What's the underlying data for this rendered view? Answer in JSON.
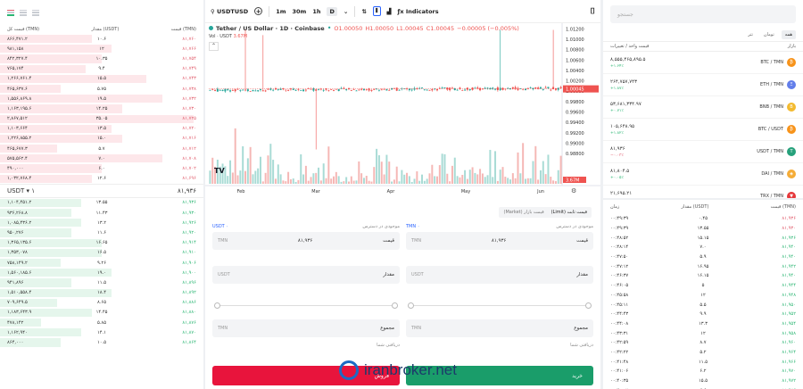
{
  "orderbook": {
    "headers": {
      "total": "قیمت کل (TMN)",
      "amount": "مقدار (USDT)",
      "price": "قیمت (TMN)"
    },
    "asks": [
      {
        "total": "۸۶۶,۴۷۱.۲",
        "amount": "۱۰.۶",
        "price": "۸۱,۷۶۰",
        "fill": 0.45
      },
      {
        "total": "۹۸۱,۱۵۸",
        "amount": "۱۲",
        "price": "۸۱,۷۶۶",
        "fill": 0.55
      },
      {
        "total": "۸۴۲,۳۲۷.۴",
        "amount": "۱۰.۳۵",
        "price": "۸۱,۷۵۴",
        "fill": 0.5
      },
      {
        "total": "۷۶۵,۱۷۴",
        "amount": "۹.۴",
        "price": "۸۱,۷۴۹",
        "fill": 0.42
      },
      {
        "total": "۱,۲۶۶,۷۶۱.۴",
        "amount": "۱۵.۵",
        "price": "۸۱,۷۴۳",
        "fill": 0.72
      },
      {
        "total": "۴۶۵,۶۳۷.۶",
        "amount": "۵.۷۵",
        "price": "۸۱,۷۳۸",
        "fill": 0.3
      },
      {
        "total": "۱,۵۵۶,۸۶۹.۸",
        "amount": "۱۹.۵",
        "price": "۸۱,۷۳۲",
        "fill": 0.8
      },
      {
        "total": "۱,۱۶۳,۱۹۵.۶",
        "amount": "۱۴.۲۵",
        "price": "۸۱,۷۳۰",
        "fill": 0.6
      },
      {
        "total": "۲,۸۶۷,۵۱۲",
        "amount": "۳۵.۰۵",
        "price": "۸۱,۷۲۵",
        "fill": 0.95
      },
      {
        "total": "۱,۱۰۳,۶۶۴",
        "amount": "۱۳.۵",
        "price": "۸۱,۷۲۰",
        "fill": 0.55
      },
      {
        "total": "۱,۲۲۶,۸۵۵.۲",
        "amount": "۱۵.۰",
        "price": "۸۱,۷۱۶",
        "fill": 0.6
      },
      {
        "total": "۴۶۵,۶۷۷.۳",
        "amount": "۵.۷",
        "price": "۸۱,۷۱۲",
        "fill": 0.28
      },
      {
        "total": "۵۷۵,۵۶۲.۴",
        "amount": "۷.۰",
        "price": "۸۱,۷۰۸",
        "fill": 0.8
      },
      {
        "total": "۴۹۰,۰۰۰",
        "amount": "۶.۰",
        "price": "۸۱,۷۰۲",
        "fill": 0.5
      },
      {
        "total": "۱,۰۳۲,۷۶۸.۴",
        "amount": "۱۲.۶",
        "price": "۸۱,۶۹۶",
        "fill": 0.45
      }
    ],
    "mid": {
      "unit": "USDT ▾ ۱",
      "price": "۸۱,۹۳۶"
    },
    "bids": [
      {
        "total": "۱,۱۰۴,۴۵۱.۲",
        "amount": "۱۳.۵۵",
        "price": "۸۱,۹۳۶",
        "fill": 0.4
      },
      {
        "total": "۹۳۶,۲۶۸.۸",
        "amount": "۱۱.۴۳",
        "price": "۸۱,۹۳۰",
        "fill": 0.35
      },
      {
        "total": "۱,۰۸۵,۴۳۶.۲",
        "amount": "۱۳.۲",
        "price": "۸۱,۹۲۶",
        "fill": 0.4
      },
      {
        "total": "۹۵۰,۲۷۶",
        "amount": "۱۱.۶",
        "price": "۸۱,۹۲۰",
        "fill": 0.35
      },
      {
        "total": "۱,۳۶۵,۱۳۵.۶",
        "amount": "۱۶.۶۵",
        "price": "۸۱,۹۱۴",
        "fill": 0.5
      },
      {
        "total": "۱,۳۵۳,۰۷۸",
        "amount": "۱۶.۵",
        "price": "۸۱,۹۱۰",
        "fill": 0.5
      },
      {
        "total": "۷۵۸,۱۴۹.۲",
        "amount": "۹.۲۶",
        "price": "۸۱,۹۰۶",
        "fill": 0.3
      },
      {
        "total": "۱,۵۶۰,۱۸۵.۶",
        "amount": "۱۹.۰",
        "price": "۸۱,۹۰۰",
        "fill": 0.55
      },
      {
        "total": "۹۴۱,۸۹۶",
        "amount": "۱۱.۵",
        "price": "۸۱,۸۹۶",
        "fill": 0.35
      },
      {
        "total": "۱,۵۱۰,۵۵۸.۴",
        "amount": "۱۸.۴",
        "price": "۸۱,۸۹۲",
        "fill": 0.55
      },
      {
        "total": "۷۰۹,۶۴۹.۵",
        "amount": "۸.۶۵",
        "price": "۸۱,۸۸۶",
        "fill": 0.28
      },
      {
        "total": "۱,۱۸۳,۶۴۳.۹",
        "amount": "۱۴.۴۵",
        "price": "۸۱,۸۸۰",
        "fill": 0.45
      },
      {
        "total": "۴۷۸,۱۴۲",
        "amount": "۵.۸۵",
        "price": "۸۱,۸۷۶",
        "fill": 0.2
      },
      {
        "total": "۱,۱۶۲,۹۴۰",
        "amount": "۱۴.۱",
        "price": "۸۱,۸۷۰",
        "fill": 0.4
      },
      {
        "total": "۸۶۴,۰۰۰",
        "amount": "۱۰.۵",
        "price": "۸۱,۸۶۴",
        "fill": 0.3
      }
    ]
  },
  "chart": {
    "toolbar": {
      "symbol": "USDTUSD",
      "add": "+",
      "tf1": "1m",
      "tf2": "30m",
      "tf3": "1h",
      "tf4": "D",
      "indicators": "Indicators"
    },
    "legend": {
      "name": "Tether / US Dollar · 1D · Coinbase",
      "o": "O1.00050",
      "h": "H1.00050",
      "l": "L1.00045",
      "c": "C1.00045",
      "chg": "−0.00005 (−0.005%)"
    },
    "vol": {
      "label": "Vol · USDT",
      "value": "3.67M"
    },
    "logo": "TV",
    "last_price": "1.00045",
    "last_vol": "3.67M"
  },
  "chart_data": {
    "type": "candlestick",
    "y_ticks": [
      "1.01200",
      "1.01000",
      "1.00800",
      "1.00600",
      "1.00400",
      "1.00200",
      "1.00000",
      "0.99800",
      "0.99600",
      "0.99400",
      "0.99200",
      "0.99000",
      "0.98800"
    ],
    "x_ticks": [
      "Feb",
      "Mar",
      "Apr",
      "May",
      "Jun"
    ],
    "ylim": [
      0.9882,
      1.0124
    ],
    "spikes": [
      {
        "at": 0.1,
        "high": 1.0118
      },
      {
        "at": 0.15,
        "high": 1.0108
      },
      {
        "at": 0.3,
        "low": 0.9888
      },
      {
        "at": 0.82,
        "high": 1.0118
      },
      {
        "at": 0.97,
        "high": 1.0118
      }
    ]
  },
  "form": {
    "tabs": {
      "limit": "قیمت ثابت (Limit)",
      "market": "قیمت بازار (Market)"
    },
    "buy": {
      "avail_label": "موجودی در دسترس",
      "avail_value": "۰ TMN",
      "price_label": "قیمت",
      "price_value": "۸۱,۹۳۶",
      "price_unit": "TMN",
      "amount_label": "مقدار",
      "amount_unit": "USDT",
      "total_label": "مجموع",
      "total_unit": "TMN",
      "fee": "دریافتی شما",
      "button": "خرید"
    },
    "sell": {
      "avail_label": "موجودی در دسترس",
      "avail_value": "۰ USDT",
      "price_label": "قیمت",
      "price_value": "۸۱,۹۳۶",
      "price_unit": "TMN",
      "amount_label": "مقدار",
      "amount_unit": "USDT",
      "total_label": "مجموع",
      "total_unit": "TMN",
      "fee": "دریافتی شما",
      "button": "فروش"
    }
  },
  "markets": {
    "search_placeholder": "جستجو",
    "tabs": [
      "همه",
      "تومان",
      "تتر"
    ],
    "headers": {
      "market": "بازار",
      "price": "قیمت واحد / تغییرات"
    },
    "items": [
      {
        "pair": "BTC / TMN",
        "price": "۸,۵۵۵,۴۶۵,۸۹۵.۵",
        "chg": "+۱.۶۴٪",
        "color": "#f7931a",
        "glyph": "₿"
      },
      {
        "pair": "ETH / TMN",
        "price": "۲۶۴,۷۵۷,۷۴۳",
        "chg": "+۱.۸۷٪",
        "color": "#627eea",
        "glyph": "Ξ"
      },
      {
        "pair": "BNB / TMN",
        "price": "۵۳,۶۸۱,۳۳۴.۹۷",
        "chg": "+۰.۷۱٪",
        "color": "#f3ba2f",
        "glyph": "B"
      },
      {
        "pair": "BTC / USDT",
        "price": "۱۰۵,۶۴۸.۹۵",
        "chg": "+۱.۸۲٪",
        "color": "#f7931a",
        "glyph": "₿"
      },
      {
        "pair": "USDT / TMN",
        "price": "۸۱,۹۳۶",
        "chg": "−۰.۰۳٪",
        "color": "#26a17b",
        "glyph": "T"
      },
      {
        "pair": "DAI / TMN",
        "price": "۸۱,۸۰۴.۵",
        "chg": "+۰.۰۵٪",
        "color": "#f5ac37",
        "glyph": "◈"
      },
      {
        "pair": "TRX / TMN",
        "price": "۲۱,۶۹۵.۲۱",
        "chg": "+۰.۴۲٪",
        "color": "#e5383b",
        "glyph": "▼"
      }
    ]
  },
  "trades": {
    "headers": {
      "time": "زمان",
      "amount": "مقدار (USDT)",
      "price": "قیمت (TMN)"
    },
    "rows": [
      {
        "time": "۰۰:۴۹:۳۹",
        "amount": "۰.۴۵",
        "price": "۸۱,۹۳۶",
        "dir": "dn"
      },
      {
        "time": "۰۰:۴۹:۳۹",
        "amount": "۱۳.۵۵",
        "price": "۸۱,۹۳۰",
        "dir": "dn"
      },
      {
        "time": "۰۰:۴۸:۵۲",
        "amount": "۱۵.۱۵",
        "price": "۸۱,۹۳۶",
        "dir": "up"
      },
      {
        "time": "۰۰:۴۸:۱۴",
        "amount": "۷.۰",
        "price": "۸۱,۹۴۰",
        "dir": "up"
      },
      {
        "time": "۰۰:۴۷:۵۰",
        "amount": "۵.۹",
        "price": "۸۱,۹۴۰",
        "dir": "up"
      },
      {
        "time": "۰۰:۴۷:۱۲",
        "amount": "۱۶.۹۵",
        "price": "۸۱,۹۴۲",
        "dir": "up"
      },
      {
        "time": "۰۰:۴۶:۳۷",
        "amount": "۱۶.۱۵",
        "price": "۸۱,۹۴۰",
        "dir": "up"
      },
      {
        "time": "۰۰:۴۶:۰۵",
        "amount": "۵",
        "price": "۸۱,۹۴۴",
        "dir": "up"
      },
      {
        "time": "۰۰:۴۵:۵۸",
        "amount": "۱۲",
        "price": "۸۱,۹۴۸",
        "dir": "up"
      },
      {
        "time": "۰۰:۴۵:۱۱",
        "amount": "۵.۵",
        "price": "۸۱,۹۵۰",
        "dir": "up"
      },
      {
        "time": "۰۰:۴۴:۴۳",
        "amount": "۹.۹",
        "price": "۸۱,۹۵۲",
        "dir": "up"
      },
      {
        "time": "۰۰:۴۴:۰۸",
        "amount": "۱۳.۳",
        "price": "۸۱,۹۵۴",
        "dir": "up"
      },
      {
        "time": "۰۰:۴۳:۳۱",
        "amount": "۱۲",
        "price": "۸۱,۹۵۸",
        "dir": "up"
      },
      {
        "time": "۰۰:۴۲:۵۹",
        "amount": "۸.۷",
        "price": "۸۱,۹۶۰",
        "dir": "up"
      },
      {
        "time": "۰۰:۴۲:۲۲",
        "amount": "۵.۲",
        "price": "۸۱,۹۶۴",
        "dir": "up"
      },
      {
        "time": "۰۰:۴۱:۴۸",
        "amount": "۱۱.۵",
        "price": "۸۱,۹۶۶",
        "dir": "up"
      },
      {
        "time": "۰۰:۴۱:۰۶",
        "amount": "۶.۲",
        "price": "۸۱,۹۷۰",
        "dir": "up"
      },
      {
        "time": "۰۰:۴۰:۳۵",
        "amount": "۱۵.۵",
        "price": "۸۱,۹۷۲",
        "dir": "up"
      },
      {
        "time": "۰۰:۴۰:۰۲",
        "amount": "۶.۶",
        "price": "۸۱,۹۷۶",
        "dir": "up"
      }
    ]
  },
  "watermark": "iranbroker.net",
  "colors": {
    "buy": "#1a9d6a",
    "sell": "#e8143c",
    "up": "#26a69a",
    "down": "#ef5350"
  }
}
